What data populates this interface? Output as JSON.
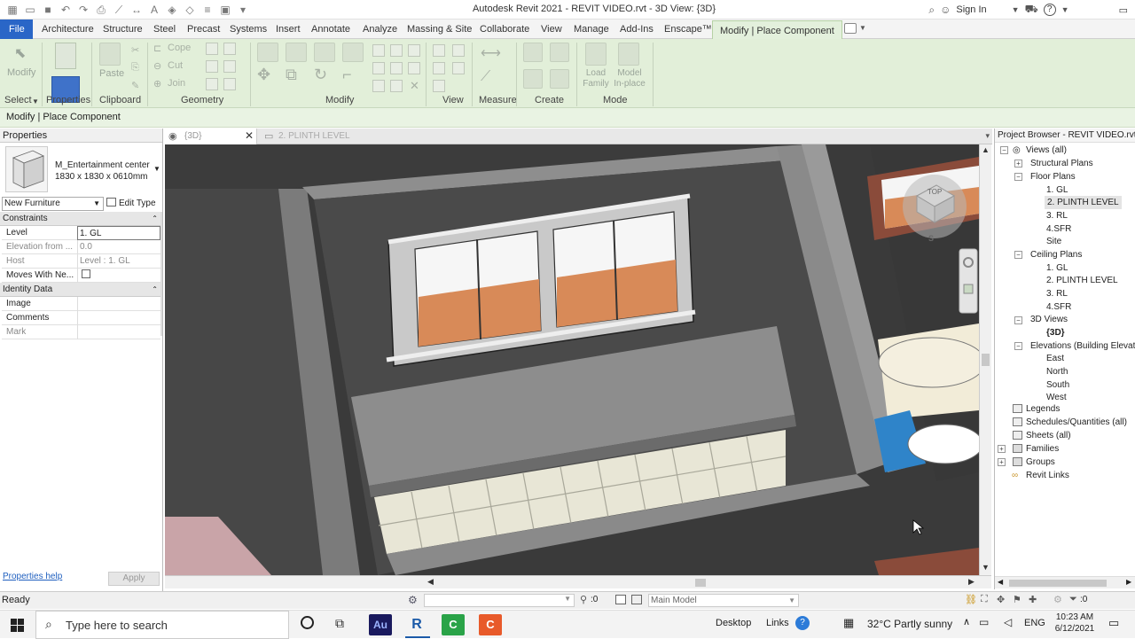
{
  "window": {
    "title": "Autodesk Revit 2021 - REVIT VIDEO.rvt - 3D View: {3D}",
    "sign_in": "Sign In"
  },
  "ribbon_tabs": [
    "File",
    "Architecture",
    "Structure",
    "Steel",
    "Precast",
    "Systems",
    "Insert",
    "Annotate",
    "Analyze",
    "Massing & Site",
    "Collaborate",
    "View",
    "Manage",
    "Add-Ins",
    "Enscape™",
    "Modify | Place Component"
  ],
  "ribbon": {
    "select_label": "Select",
    "properties_label": "Properties",
    "clipboard_label": "Clipboard",
    "geometry_label": "Geometry",
    "modify_label": "Modify",
    "view_label": "View",
    "measure_label": "Measure",
    "create_label": "Create",
    "mode_label": "Mode",
    "modify_btn": "Modify",
    "paste_btn": "Paste",
    "cope_btn": "Cope",
    "cut_btn": "Cut",
    "join_btn": "Join",
    "load_family": "Load Family",
    "model_inplace": "Model In-place"
  },
  "options_bar": "Modify | Place Component",
  "properties": {
    "title": "Properties",
    "family_name": "M_Entertainment center",
    "family_size": "1830 x 1830 x 0610mm",
    "type_selector": "New Furniture",
    "edit_type": "Edit Type",
    "sections": [
      "Constraints",
      "Identity Data"
    ],
    "rows": [
      {
        "k": "Level",
        "v": "1. GL"
      },
      {
        "k": "Elevation from ...",
        "v": "0.0"
      },
      {
        "k": "Host",
        "v": "Level : 1. GL"
      },
      {
        "k": "Moves With Ne...",
        "v": ""
      }
    ],
    "identity_rows": [
      {
        "k": "Image",
        "v": ""
      },
      {
        "k": "Comments",
        "v": ""
      },
      {
        "k": "Mark",
        "v": ""
      }
    ],
    "help": "Properties help",
    "apply": "Apply"
  },
  "view_tabs": [
    {
      "label": "{3D}"
    },
    {
      "label": "2. PLINTH LEVEL"
    }
  ],
  "viewcube": {
    "top": "TOP",
    "south": "S"
  },
  "project_browser": {
    "title": "Project Browser - REVIT VIDEO.rvt",
    "items": [
      {
        "label": "Views (all)"
      },
      {
        "label": "Structural Plans"
      },
      {
        "label": "Floor Plans"
      },
      {
        "label": "1. GL"
      },
      {
        "label": "2. PLINTH LEVEL"
      },
      {
        "label": "3. RL"
      },
      {
        "label": "4.SFR"
      },
      {
        "label": "Site"
      },
      {
        "label": "Ceiling Plans"
      },
      {
        "label": "1. GL"
      },
      {
        "label": "2. PLINTH LEVEL"
      },
      {
        "label": "3. RL"
      },
      {
        "label": "4.SFR"
      },
      {
        "label": "3D Views"
      },
      {
        "label": "{3D}"
      },
      {
        "label": "Elevations (Building Elevat"
      },
      {
        "label": "East"
      },
      {
        "label": "North"
      },
      {
        "label": "South"
      },
      {
        "label": "West"
      },
      {
        "label": "Legends"
      },
      {
        "label": "Schedules/Quantities (all)"
      },
      {
        "label": "Sheets (all)"
      },
      {
        "label": "Families"
      },
      {
        "label": "Groups"
      },
      {
        "label": "Revit Links"
      }
    ]
  },
  "status": {
    "ready": "Ready",
    "selection_count": ":0",
    "model": "Main Model",
    "filter_count": ":0"
  },
  "taskbar": {
    "search_placeholder": "Type here to search",
    "desktop": "Desktop",
    "links": "Links",
    "weather": "32°C  Partly sunny",
    "lang": "ENG",
    "time": "10:23 AM",
    "date": "6/12/2021",
    "apps": [
      "Au",
      "R",
      "C",
      "C"
    ]
  }
}
